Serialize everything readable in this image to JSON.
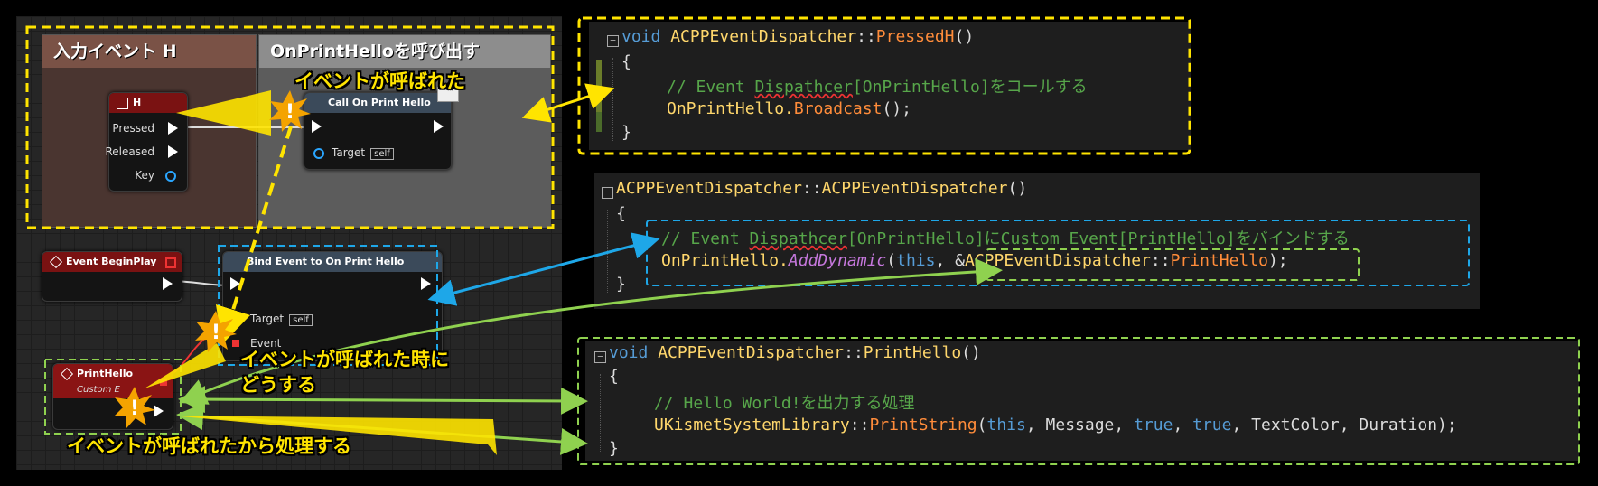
{
  "comments": {
    "input_event": "入力イベント H",
    "call_dispatcher": "OnPrintHelloを呼び出す"
  },
  "nodes": {
    "h_key": {
      "title": "H",
      "pins": [
        "Pressed",
        "Released",
        "Key"
      ]
    },
    "call_print_hello": {
      "title": "Call On Print Hello",
      "target_label": "Target",
      "target_value": "self"
    },
    "begin_play": {
      "title": "Event BeginPlay"
    },
    "bind_event": {
      "title": "Bind Event to On Print Hello",
      "target_label": "Target",
      "target_value": "self",
      "event_label": "Event"
    },
    "print_hello": {
      "title": "PrintHello",
      "subtitle": "Custom E"
    }
  },
  "callouts": {
    "event_called": "イベントが呼ばれた",
    "when_called_1": "イベントが呼ばれた時に",
    "when_called_2": "どうする",
    "process_after_call": "イベントが呼ばれたから処理する"
  },
  "code1": {
    "l1_kw": "void",
    "l1_cls": "ACPPEventDispatcher",
    "l1_sep": "::",
    "l1_fn": "PressedH",
    "l1_end": "()",
    "l2": "{",
    "l3_a": "// Event ",
    "l3_b": "Dispathcer",
    "l3_c": "[OnPrintHello]をコールする",
    "l4_a": "OnPrintHello.",
    "l4_fn": "Broadcast",
    "l4_end": "();",
    "l5": "}"
  },
  "code2": {
    "l1_cls": "ACPPEventDispatcher",
    "l1_sep": "::",
    "l1_fn": "ACPPEventDispatcher",
    "l1_end": "()",
    "l2": "{",
    "l3_a": "// Event ",
    "l3_b": "Dispathcer",
    "l3_c": "[OnPrintHello]にCustom Event[PrintHello]をバインドする",
    "l4_a": "OnPrintHello.",
    "l4_fn": "AddDynamic",
    "l4_b": "(",
    "l4_this": "this",
    "l4_c": ", &",
    "l4_cls": "ACPPEventDispatcher",
    "l4_sep": "::",
    "l4_fn2": "PrintHello",
    "l4_end": ");",
    "l5": "}"
  },
  "code3": {
    "l1_kw": "void",
    "l1_cls": "ACPPEventDispatcher",
    "l1_sep": "::",
    "l1_fn": "PrintHello",
    "l1_end": "()",
    "l2": "{",
    "l3": "// Hello World!を出力する処理",
    "l4_cls": "UKismetSystemLibrary",
    "l4_sep": "::",
    "l4_fn": "PrintString",
    "l4_b": "(",
    "l4_this": "this",
    "l4_c": ", Message, ",
    "l4_t1": "true",
    "l4_d": ", ",
    "l4_t2": "true",
    "l4_e": ", TextColor, Duration);",
    "l5": "}"
  },
  "colors": {
    "highlight_yellow": "#ffe400",
    "highlight_blue": "#1ea7e8",
    "highlight_green": "#8fd14f"
  }
}
